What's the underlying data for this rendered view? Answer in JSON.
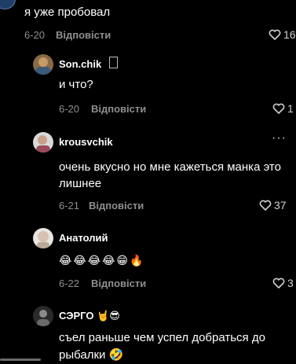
{
  "colors": {
    "background": "#000000",
    "text": "#ffffff",
    "muted": "#8e8e8e"
  },
  "top_comment": {
    "text": "я уже пробовал",
    "date": "6-20",
    "reply": "Відповісти",
    "likes": "16"
  },
  "replies": [
    {
      "username": "Son.chik",
      "text": "и что?",
      "date": "6-20",
      "reply": "Відповісти",
      "likes": "1"
    },
    {
      "username": "krousvchik",
      "text_line1": "очень вкусно но мне кажеться манка это",
      "text_line2": "лишнее",
      "date": "6-21",
      "reply": "Відповісти",
      "likes": "37"
    },
    {
      "username": "Анатолий",
      "emoji": "😂😂😂😂😁🔥",
      "date": "6-22",
      "reply": "Відповісти",
      "likes": "3"
    },
    {
      "username": "СЭРГО 🤘😎",
      "text_line1": "съел раньше чем успел добраться до",
      "text_line2": "рыбалки 🤣"
    }
  ]
}
